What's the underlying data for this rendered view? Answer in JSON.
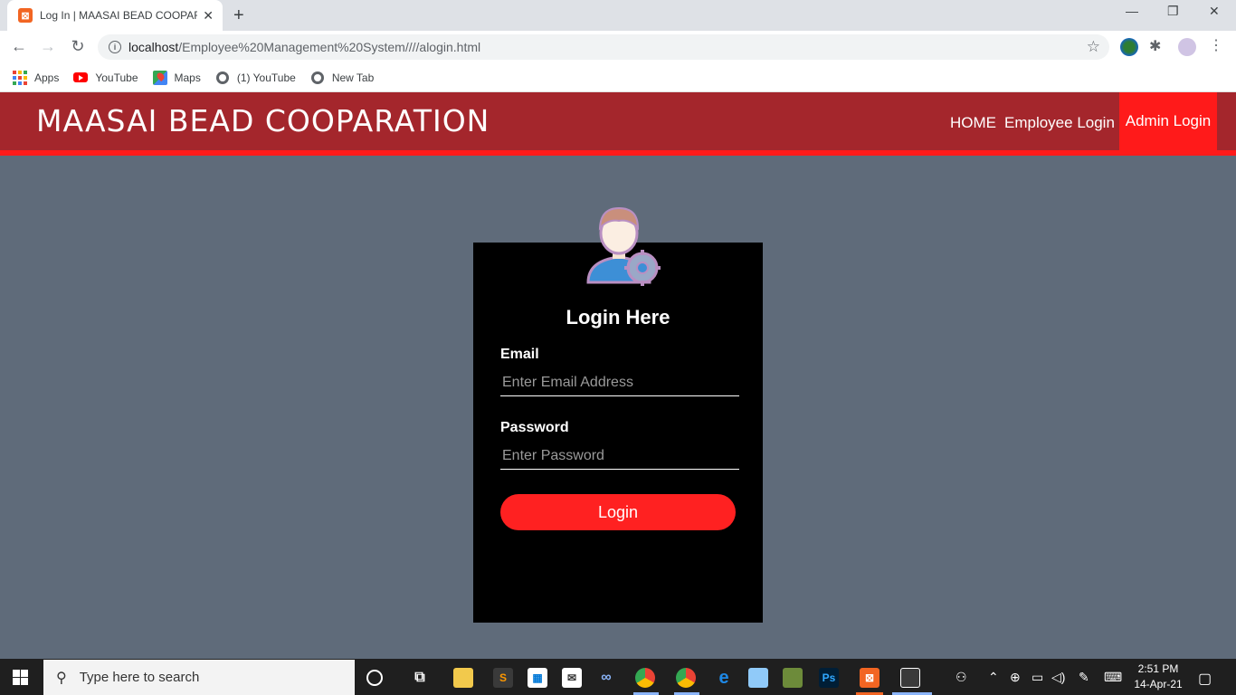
{
  "browser": {
    "tab_title": "Log In | MAASAI BEAD COOPARATION",
    "tab_favicon": "xampp-icon",
    "url_host": "localhost",
    "url_path": "/Employee%20Management%20System////alogin.html",
    "bookmarks": [
      {
        "label": "Apps",
        "icon": "apps-grid-icon"
      },
      {
        "label": "YouTube",
        "icon": "youtube-icon"
      },
      {
        "label": "Maps",
        "icon": "maps-icon"
      },
      {
        "label": "(1) YouTube",
        "icon": "globe-icon"
      },
      {
        "label": "New Tab",
        "icon": "globe-icon"
      }
    ]
  },
  "header": {
    "brand": "MAASAI BEAD COOPARATION",
    "nav": {
      "home": "HOME",
      "employee_login": "Employee Login",
      "admin_login": "Admin Login"
    }
  },
  "login_card": {
    "title": "Login Here",
    "email_label": "Email",
    "email_placeholder": "Enter Email Address",
    "password_label": "Password",
    "password_placeholder": "Enter Password",
    "button_label": "Login"
  },
  "taskbar": {
    "search_placeholder": "Type here to search",
    "time": "2:51 PM",
    "date": "14-Apr-21"
  },
  "colors": {
    "header_bg": "#a4262c",
    "accent_red": "#ff1a1a",
    "page_bg": "#5f6b7a",
    "card_bg": "#000000",
    "button_bg": "#ff2121"
  }
}
